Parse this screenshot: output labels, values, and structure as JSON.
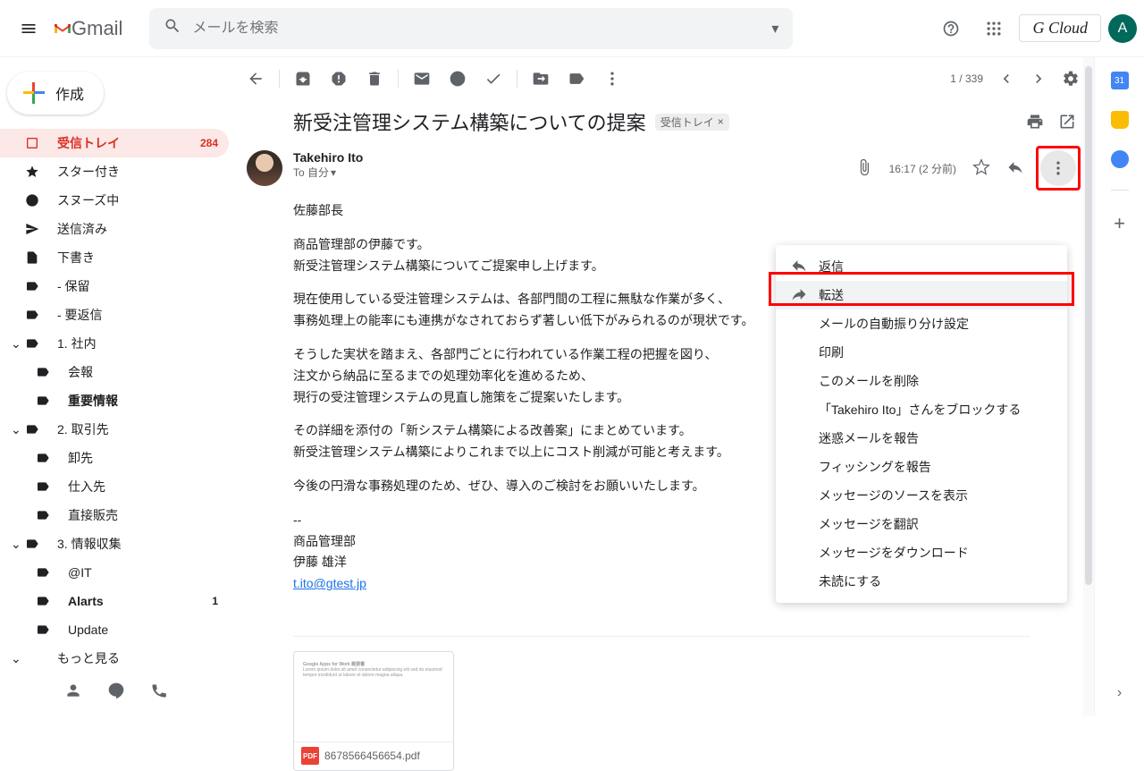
{
  "header": {
    "logo_text": "Gmail",
    "search_placeholder": "メールを検索",
    "brand": "G Cloud",
    "avatar_letter": "A"
  },
  "compose_label": "作成",
  "sidebar": {
    "items": [
      {
        "label": "受信トレイ",
        "count": "284",
        "active": true
      },
      {
        "label": "スター付き"
      },
      {
        "label": "スヌーズ中"
      },
      {
        "label": "送信済み"
      },
      {
        "label": "下書き"
      },
      {
        "label": "- 保留"
      },
      {
        "label": "- 要返信"
      }
    ],
    "groups": [
      {
        "label": "1. 社内",
        "children": [
          {
            "label": "会報"
          },
          {
            "label": "重要情報",
            "bold": true
          }
        ]
      },
      {
        "label": "2. 取引先",
        "children": [
          {
            "label": "卸先"
          },
          {
            "label": "仕入先"
          },
          {
            "label": "直接販売"
          }
        ]
      },
      {
        "label": "3. 情報収集",
        "children": [
          {
            "label": "@IT"
          },
          {
            "label": "Alarts",
            "bold": true,
            "count": "1"
          },
          {
            "label": "Update"
          }
        ]
      }
    ],
    "more": "もっと見る"
  },
  "toolbar": {
    "pager": "1 / 339"
  },
  "message": {
    "subject": "新受注管理システム構築についての提案",
    "label_chip": "受信トレイ",
    "sender": "Takehiro Ito",
    "to_line": "To 自分",
    "time": "16:17 (2 分前)",
    "body_lines": [
      "佐藤部長",
      "商品管理部の伊藤です。\n新受注管理システム構築についてご提案申し上げます。",
      "現在使用している受注管理システムは、各部門間の工程に無駄な作業が多く、\n事務処理上の能率にも連携がなされておらず著しい低下がみられるのが現状です。",
      "そうした実状を踏まえ、各部門ごとに行われている作業工程の把握を図り、\n注文から納品に至るまでの処理効率化を進めるため、\n現行の受注管理システムの見直し施策をご提案いたします。",
      "その詳細を添付の「新システム構築による改善案」にまとめています。\n新受注管理システム構築によりこれまで以上にコスト削減が可能と考えます。",
      "今後の円滑な事務処理のため、ぜひ、導入のご検討をお願いいたします。"
    ],
    "signature_lines": [
      "--",
      "商品管理部",
      "伊藤 雄洋"
    ],
    "email_link": "t.ito@gtest.jp",
    "attachment": {
      "name": "8678566456654.pdf",
      "badge": "PDF",
      "preview_title": "Google Apps for Work 概要書"
    }
  },
  "context_menu": {
    "items": [
      {
        "label": "返信",
        "icon": "reply"
      },
      {
        "label": "転送",
        "icon": "forward",
        "highlight": true
      },
      {
        "label": "メールの自動振り分け設定"
      },
      {
        "label": "印刷"
      },
      {
        "label": "このメールを削除"
      },
      {
        "label": "「Takehiro Ito」さんをブロックする"
      },
      {
        "label": "迷惑メールを報告"
      },
      {
        "label": "フィッシングを報告"
      },
      {
        "label": "メッセージのソースを表示"
      },
      {
        "label": "メッセージを翻訳"
      },
      {
        "label": "メッセージをダウンロード"
      },
      {
        "label": "未読にする"
      }
    ]
  }
}
